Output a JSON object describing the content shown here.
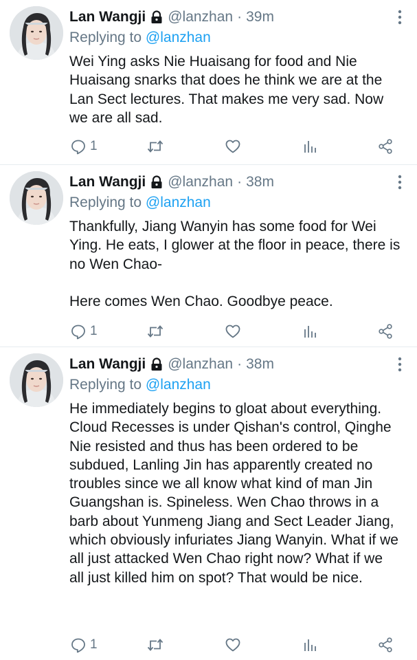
{
  "tweets": [
    {
      "author_name": "Lan Wangji",
      "handle": "@lanzhan",
      "separator": "·",
      "time": "39m",
      "reply_prefix": "Replying to ",
      "reply_to": "@lanzhan",
      "text": "Wei Ying asks Nie Huaisang for food and Nie Huaisang snarks that does he think we are at the Lan Sect lectures. That makes me very sad. Now we are all sad.",
      "reply_count": "1"
    },
    {
      "author_name": "Lan Wangji",
      "handle": "@lanzhan",
      "separator": "·",
      "time": "38m",
      "reply_prefix": "Replying to ",
      "reply_to": "@lanzhan",
      "text": "Thankfully, Jiang Wanyin has some food for Wei Ying. He eats, I glower at the floor in peace, there is no Wen Chao-\n\nHere comes Wen Chao. Goodbye peace.",
      "reply_count": "1"
    },
    {
      "author_name": "Lan Wangji",
      "handle": "@lanzhan",
      "separator": "·",
      "time": "38m",
      "reply_prefix": "Replying to ",
      "reply_to": "@lanzhan",
      "text": "He immediately begins to gloat about everything. Cloud Recesses is under Qishan's control, Qinghe Nie resisted and thus has been ordered to be subdued, Lanling Jin has apparently created no troubles since we all know what kind of man Jin Guangshan is. Spineless. Wen Chao throws in a barb about Yunmeng Jiang and Sect Leader Jiang, which obviously infuriates Jiang Wanyin. What if we all just attacked Wen Chao right now? What if we all just killed him on spot? That would be nice.",
      "reply_count": "1"
    }
  ],
  "icons": {
    "lock": "lock-icon",
    "more": "more-vertical-icon",
    "reply": "reply-icon",
    "retweet": "retweet-icon",
    "like": "heart-icon",
    "stats": "analytics-icon",
    "share": "share-icon"
  },
  "colors": {
    "text": "#14171a",
    "muted": "#657786",
    "link": "#1da1f2",
    "divider": "#e6ecf0"
  }
}
